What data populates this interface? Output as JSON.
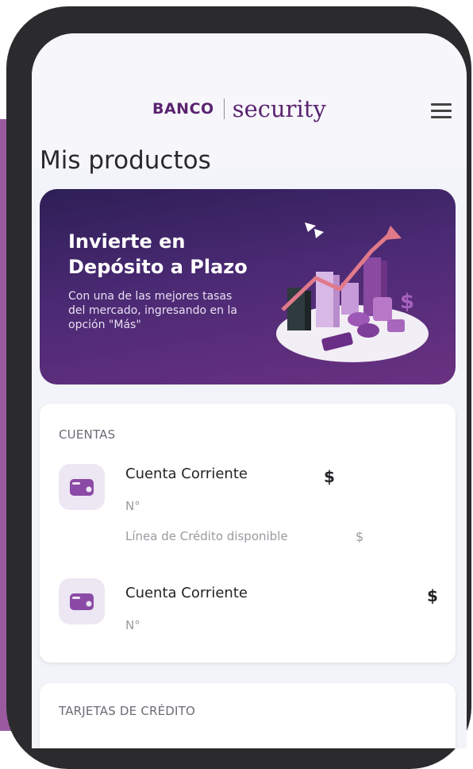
{
  "header": {
    "logo_banco": "BANCO",
    "logo_security": "security",
    "menu_icon": "hamburger-menu-icon"
  },
  "page_title": "Mis productos",
  "promo": {
    "title_line1": "Invierte en",
    "title_line2": "Depósito a Plazo",
    "description": "Con una de las mejores tasas del mercado, ingresando en la opción \"Más\"",
    "illustration": "investment-chart-illustration"
  },
  "cuentas": {
    "section_label": "CUENTAS",
    "accounts": [
      {
        "icon": "wallet-icon",
        "name": "Cuenta Corriente",
        "number_label": "N°",
        "currency": "$",
        "credit_label": "Línea de Crédito disponible",
        "credit_currency": "$"
      },
      {
        "icon": "wallet-icon",
        "name": "Cuenta Corriente",
        "number_label": "N°",
        "currency": "$"
      }
    ]
  },
  "tarjetas": {
    "section_label": "TARJETAS DE CRÉDITO"
  },
  "colors": {
    "brand_purple": "#5a2370",
    "promo_gradient_start": "#2e1f56",
    "promo_gradient_end": "#6a3181",
    "icon_purple": "#8b4aa6",
    "background_purple": "#9b5aa0"
  }
}
